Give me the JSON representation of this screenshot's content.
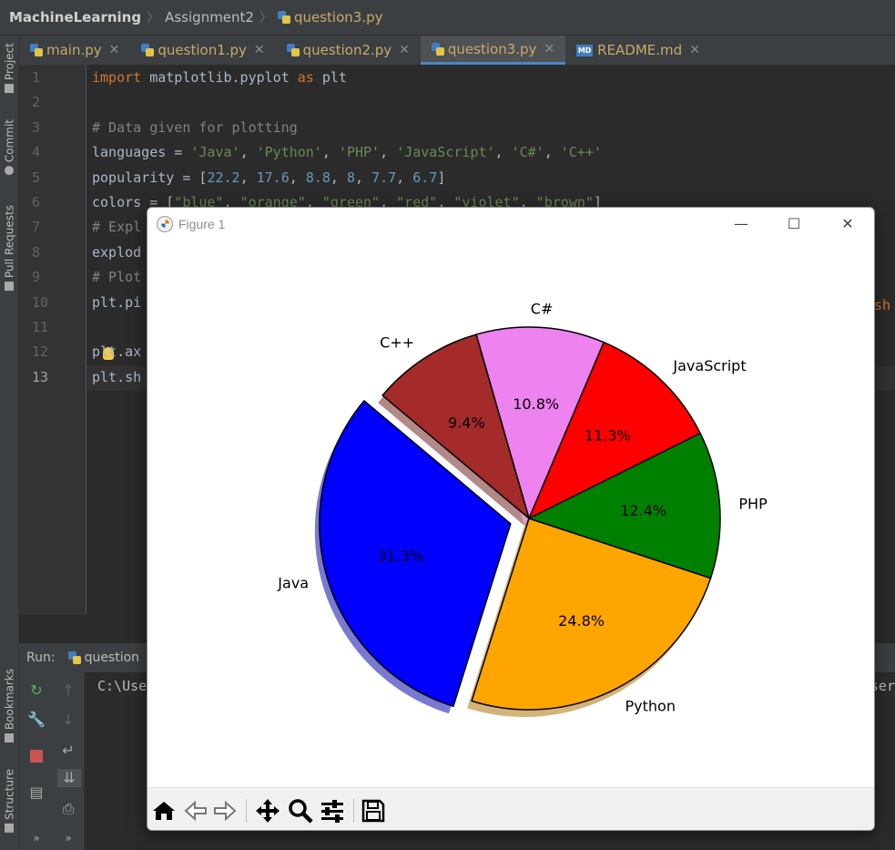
{
  "breadcrumb": {
    "project": "MachineLearning",
    "folder": "Assignment2",
    "file": "question3.py"
  },
  "left_strip": {
    "project": "Project",
    "commit": "Commit",
    "pull_requests": "Pull Requests",
    "bookmarks": "Bookmarks",
    "structure": "Structure"
  },
  "tabs": [
    {
      "label": "main.py",
      "icon": "python-file-icon"
    },
    {
      "label": "question1.py",
      "icon": "python-file-icon"
    },
    {
      "label": "question2.py",
      "icon": "python-file-icon"
    },
    {
      "label": "question3.py",
      "icon": "python-file-icon",
      "active": true
    },
    {
      "label": "README.md",
      "icon": "markdown-file-icon"
    }
  ],
  "editor": {
    "line_numbers": [
      "1",
      "2",
      "3",
      "4",
      "5",
      "6",
      "7",
      "8",
      "9",
      "10",
      "11",
      "12",
      "13"
    ],
    "current_line": "13",
    "overflow_text_line10": "sh",
    "lines": [
      [
        {
          "t": "import",
          "c": "kw"
        },
        {
          "t": " matplotlib.pyplot ",
          "c": ""
        },
        {
          "t": "as",
          "c": "kw"
        },
        {
          "t": " plt",
          "c": ""
        }
      ],
      [],
      [
        {
          "t": "# Data given for plotting",
          "c": "cm"
        }
      ],
      [
        {
          "t": "languages = ",
          "c": ""
        },
        {
          "t": "'Java'",
          "c": "st"
        },
        {
          "t": ", ",
          "c": ""
        },
        {
          "t": "'Python'",
          "c": "st"
        },
        {
          "t": ", ",
          "c": ""
        },
        {
          "t": "'PHP'",
          "c": "st"
        },
        {
          "t": ", ",
          "c": ""
        },
        {
          "t": "'JavaScript'",
          "c": "st"
        },
        {
          "t": ", ",
          "c": ""
        },
        {
          "t": "'C#'",
          "c": "st"
        },
        {
          "t": ", ",
          "c": ""
        },
        {
          "t": "'C++'",
          "c": "st"
        }
      ],
      [
        {
          "t": "popularity = [",
          "c": ""
        },
        {
          "t": "22.2",
          "c": "nu"
        },
        {
          "t": ", ",
          "c": ""
        },
        {
          "t": "17.6",
          "c": "nu"
        },
        {
          "t": ", ",
          "c": ""
        },
        {
          "t": "8.8",
          "c": "nu"
        },
        {
          "t": ", ",
          "c": ""
        },
        {
          "t": "8",
          "c": "nu"
        },
        {
          "t": ", ",
          "c": ""
        },
        {
          "t": "7.7",
          "c": "nu"
        },
        {
          "t": ", ",
          "c": ""
        },
        {
          "t": "6.7",
          "c": "nu"
        },
        {
          "t": "]",
          "c": ""
        }
      ],
      [
        {
          "t": "colors = [",
          "c": ""
        },
        {
          "t": "\"blue\"",
          "c": "st"
        },
        {
          "t": ", ",
          "c": ""
        },
        {
          "t": "\"orange\"",
          "c": "st"
        },
        {
          "t": ", ",
          "c": ""
        },
        {
          "t": "\"green\"",
          "c": "st"
        },
        {
          "t": ", ",
          "c": ""
        },
        {
          "t": "\"red\"",
          "c": "st"
        },
        {
          "t": ", ",
          "c": ""
        },
        {
          "t": "\"violet\"",
          "c": "st"
        },
        {
          "t": ", ",
          "c": ""
        },
        {
          "t": "\"brown\"",
          "c": "st"
        },
        {
          "t": "]",
          "c": ""
        }
      ],
      [
        {
          "t": "# Expl",
          "c": "cm"
        }
      ],
      [
        {
          "t": "explod",
          "c": ""
        }
      ],
      [
        {
          "t": "# Plot",
          "c": "cm"
        }
      ],
      [
        {
          "t": "plt.pi",
          "c": ""
        }
      ],
      [],
      [
        {
          "t": "plt.ax",
          "c": ""
        }
      ],
      [
        {
          "t": "plt.sh",
          "c": ""
        }
      ]
    ]
  },
  "run": {
    "label": "Run:",
    "config": "question",
    "console_left": "C:\\Use",
    "console_right": "ser"
  },
  "figure": {
    "title": "Figure 1",
    "controls": {
      "minimize": "—",
      "maximize": "☐",
      "close": "✕"
    },
    "toolbar": [
      "home-icon",
      "back-icon",
      "forward-icon",
      "pan-icon",
      "zoom-icon",
      "configure-subplots-icon",
      "save-icon"
    ]
  },
  "chart_data": {
    "type": "pie",
    "labels": [
      "Java",
      "Python",
      "PHP",
      "JavaScript",
      "C#",
      "C++"
    ],
    "values": [
      22.2,
      17.6,
      8.8,
      8,
      7.7,
      6.7
    ],
    "autopct_labels": [
      "31.3%",
      "24.8%",
      "12.4%",
      "11.3%",
      "10.8%",
      "9.4%"
    ],
    "colors": [
      "#0000ff",
      "#ffa500",
      "#008000",
      "#ff0000",
      "#ee82ee",
      "#a52a2a"
    ],
    "explode": [
      0.1,
      0,
      0,
      0,
      0,
      0
    ],
    "start_angle": 140,
    "shadow": true,
    "axis": "equal"
  },
  "colors": {
    "editor_bg": "#2b2b2b",
    "keyword": "#cc7832",
    "string": "#6a8759",
    "number": "#6897bb",
    "comment": "#808080",
    "active_tab_underline": "#4a88c7"
  }
}
